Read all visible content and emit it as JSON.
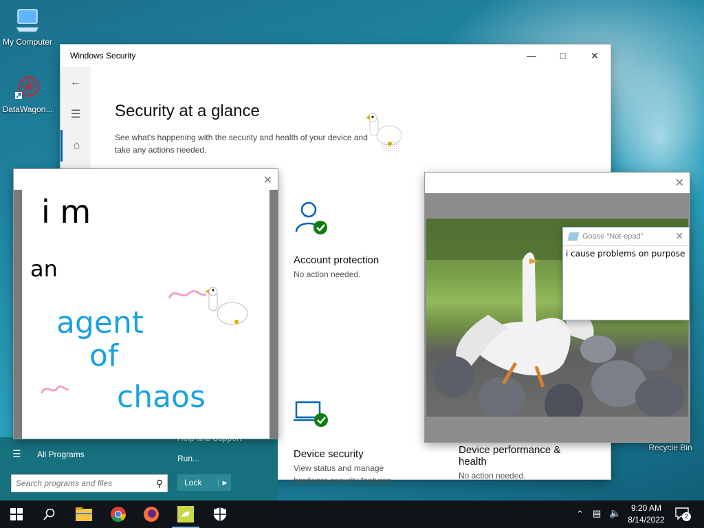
{
  "desktop": {
    "icons": [
      {
        "label": "My Computer",
        "icon": "computer-icon"
      },
      {
        "label": "DataWagon...",
        "icon": "datawagon-icon"
      },
      {
        "label": "Recycle Bin",
        "icon": "recycle-bin-icon"
      }
    ]
  },
  "windows_security": {
    "title": "Windows Security",
    "heading": "Security at a glance",
    "subtitle": "See what's happening with the security and health of your device and take any actions needed.",
    "tiles": [
      {
        "title": "Account protection",
        "text": "No action needed.",
        "icon": "account-check-icon"
      },
      {
        "title": "Device security",
        "text": "View status and manage hardware security features",
        "icon": "laptop-check-icon"
      },
      {
        "title": "Device performance & health",
        "text": "No action needed.",
        "icon": "performance-icon"
      }
    ]
  },
  "paint": {
    "drawing_lines": [
      "i m",
      "an",
      "agent",
      "of",
      "chaos"
    ]
  },
  "notepad": {
    "title": "Goose \"Not-epad\"",
    "text": "i cause problems on purpose"
  },
  "start_menu": {
    "all_programs": "All Programs",
    "help": "Help and Support",
    "run": "Run...",
    "lock": "Lock",
    "search_placeholder": "Search programs and files"
  },
  "taskbar": {
    "time": "9:20 AM",
    "date": "8/14/2022",
    "notifications": "2"
  },
  "colors": {
    "accent": "#0063b1",
    "ok": "#107c10",
    "start_bg": "#16707e"
  }
}
